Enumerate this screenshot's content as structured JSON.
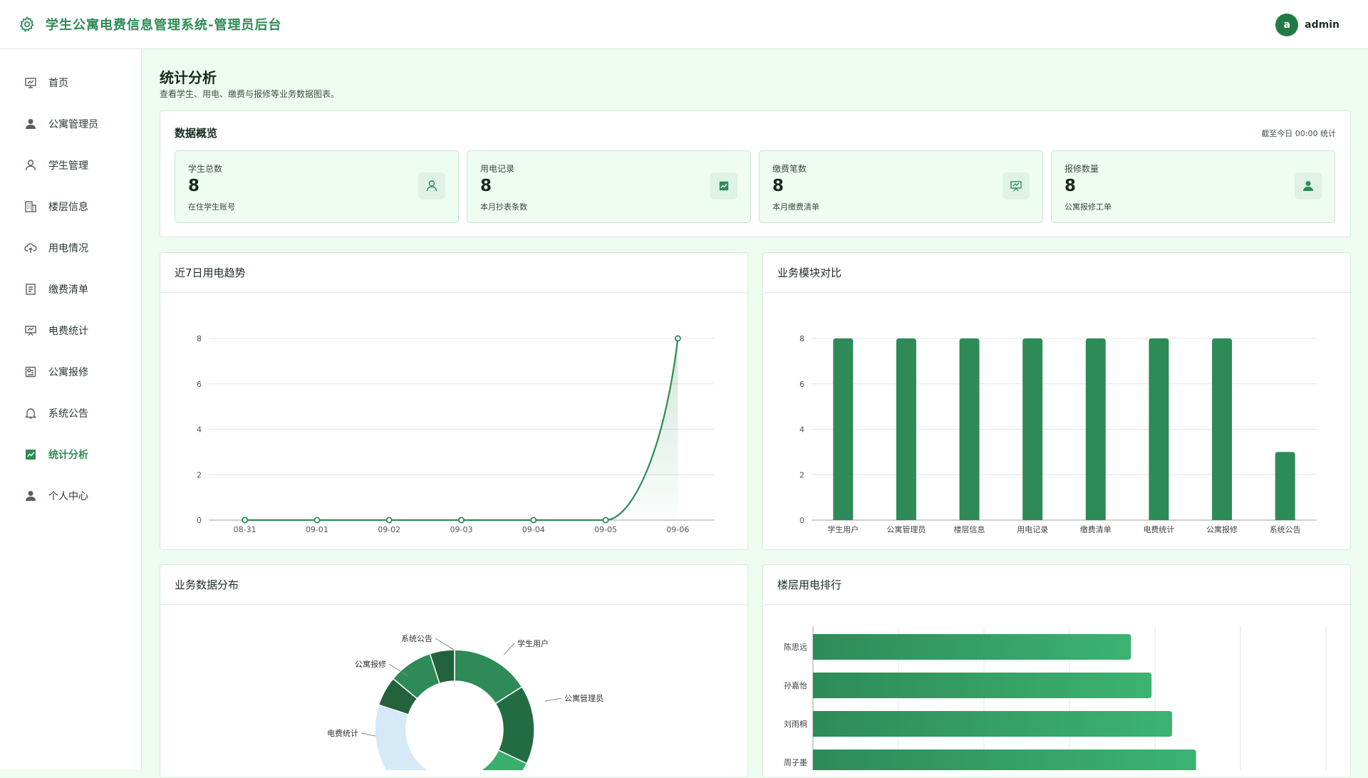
{
  "app": {
    "title": "学生公寓电费信息管理系统-管理员后台",
    "user_initial": "a",
    "user_name": "admin"
  },
  "sidebar": {
    "items": [
      {
        "label": "首页",
        "icon": "dashboard-icon"
      },
      {
        "label": "公寓管理员",
        "icon": "user-filled-icon"
      },
      {
        "label": "学生管理",
        "icon": "user-icon"
      },
      {
        "label": "楼层信息",
        "icon": "building-icon"
      },
      {
        "label": "用电情况",
        "icon": "cloud-upload-icon"
      },
      {
        "label": "缴费清单",
        "icon": "document-icon"
      },
      {
        "label": "电费统计",
        "icon": "presentation-icon"
      },
      {
        "label": "公寓报修",
        "icon": "repair-icon"
      },
      {
        "label": "系统公告",
        "icon": "bell-icon"
      },
      {
        "label": "统计分析",
        "icon": "chart-icon",
        "active": true
      },
      {
        "label": "个人中心",
        "icon": "user-filled-icon"
      }
    ]
  },
  "page": {
    "title": "统计分析",
    "subtitle": "查看学生、用电、缴费与报修等业务数据图表。"
  },
  "overview": {
    "title": "数据概览",
    "note": "截至今日 00:00 统计",
    "stats": [
      {
        "label": "学生总数",
        "value": "8",
        "note": "在住学生账号",
        "icon": "user-icon"
      },
      {
        "label": "用电记录",
        "value": "8",
        "note": "本月抄表条数",
        "icon": "chart-icon"
      },
      {
        "label": "缴费笔数",
        "value": "8",
        "note": "本月缴费清单",
        "icon": "presentation-icon"
      },
      {
        "label": "报修数量",
        "value": "8",
        "note": "公寓报修工单",
        "icon": "user-filled-icon"
      }
    ]
  },
  "charts": {
    "trend_title": "近7日用电趋势",
    "compare_title": "业务模块对比",
    "distribution_title": "业务数据分布",
    "ranking_title": "楼层用电排行"
  },
  "colors": {
    "accent": "#2e8b57",
    "dark": "#237a46",
    "background": "#eefbf1"
  },
  "chart_data": [
    {
      "type": "line",
      "title": "近7日用电趋势",
      "x": [
        "08-31",
        "09-01",
        "09-02",
        "09-03",
        "09-04",
        "09-05",
        "09-06"
      ],
      "values": [
        0,
        0,
        0,
        0,
        0,
        0,
        8
      ],
      "ylim": [
        0,
        8
      ],
      "yticks": [
        "0",
        "2",
        "4",
        "6",
        "8"
      ],
      "grid": true
    },
    {
      "type": "bar",
      "title": "业务模块对比",
      "categories": [
        "学生用户",
        "公寓管理员",
        "楼层信息",
        "用电记录",
        "缴费清单",
        "电费统计",
        "公寓报修",
        "系统公告"
      ],
      "values": [
        8,
        8,
        8,
        8,
        8,
        8,
        8,
        3
      ],
      "ylim": [
        0,
        8
      ],
      "yticks": [
        "0",
        "2",
        "4",
        "6",
        "8"
      ],
      "grid": true
    },
    {
      "type": "pie",
      "title": "业务数据分布",
      "labels": [
        "学生用户",
        "公寓管理员",
        "公寓报修",
        "系统公告",
        "电费统计"
      ],
      "values": [
        8,
        8,
        8,
        3,
        8
      ],
      "colors": [
        "#2e8b57",
        "#236b40",
        "#3aaf6b",
        "#23623b",
        "#d5e9f7"
      ]
    },
    {
      "type": "bar",
      "orientation": "horizontal",
      "title": "楼层用电排行",
      "categories": [
        "陈思远",
        "孙嘉怡",
        "刘雨桐",
        "周子墨"
      ],
      "values": [
        3.72,
        3.96,
        4.2,
        4.48
      ],
      "xlim": [
        0,
        6
      ],
      "grid": true
    }
  ]
}
